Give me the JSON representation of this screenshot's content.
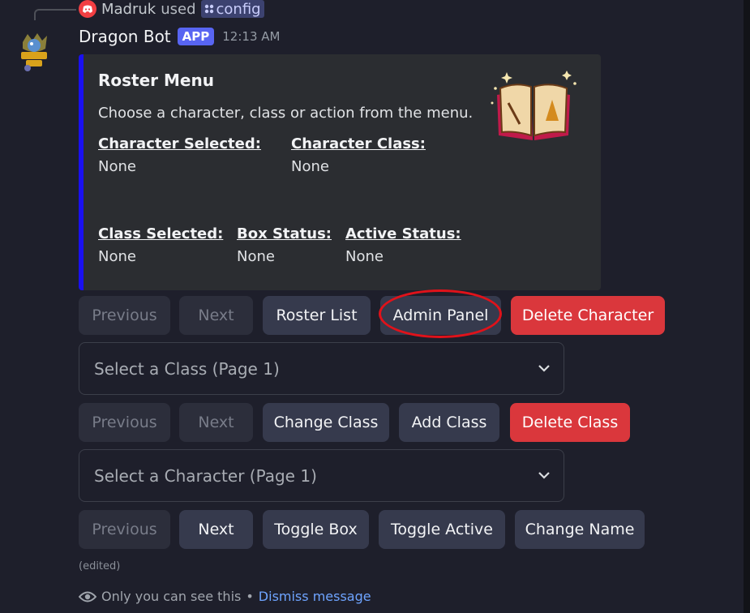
{
  "reply": {
    "user": "Madruk",
    "action": "used",
    "command": "config"
  },
  "message": {
    "bot_name": "Dragon Bot",
    "tag": "APP",
    "time": "12:13 AM"
  },
  "embed": {
    "accent_color": "#1a10f0",
    "title": "Roster Menu",
    "description": "Choose a character, class or action from the menu.",
    "fields": [
      {
        "name": "Character Selected:",
        "value": "None"
      },
      {
        "name": "Character Class:",
        "value": "None"
      },
      {
        "name": "Class Selected:",
        "value": "None"
      },
      {
        "name": "Box Status:",
        "value": "None"
      },
      {
        "name": "Active Status:",
        "value": "None"
      }
    ]
  },
  "row1": {
    "previous": "Previous",
    "next": "Next",
    "roster_list": "Roster List",
    "admin_panel": "Admin Panel",
    "delete_character": "Delete Character"
  },
  "class_select": {
    "placeholder": "Select a Class (Page 1)"
  },
  "row2": {
    "previous": "Previous",
    "next": "Next",
    "change_class": "Change Class",
    "add_class": "Add Class",
    "delete_class": "Delete Class"
  },
  "character_select": {
    "placeholder": "Select a Character (Page 1)"
  },
  "row3": {
    "previous": "Previous",
    "next": "Next",
    "toggle_box": "Toggle Box",
    "toggle_active": "Toggle Active",
    "change_name": "Change Name"
  },
  "edited": "(edited)",
  "ephemeral": {
    "text": "Only you can see this",
    "separator": "•",
    "dismiss": "Dismiss message"
  },
  "colors": {
    "danger": "#da373c",
    "secondary": "#363a4d",
    "brand": "#5865f2",
    "annotation": "#e0121a"
  }
}
